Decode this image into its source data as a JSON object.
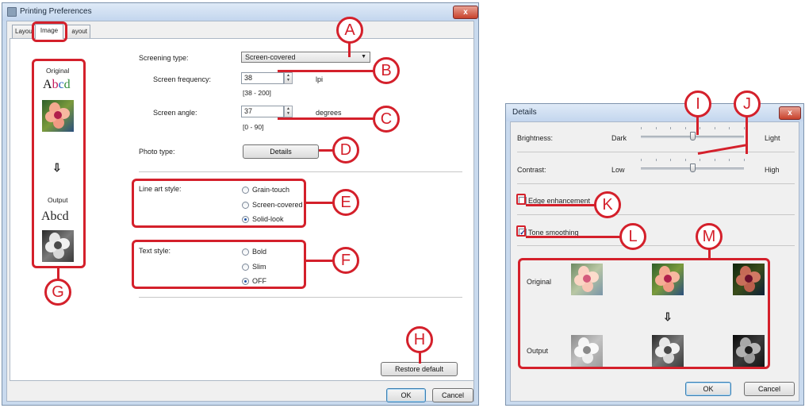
{
  "main_window": {
    "title": "Printing Preferences",
    "close_label": "x",
    "tabs": [
      "Layou",
      "Image",
      "ayout"
    ],
    "preview": {
      "original_label": "Original",
      "sample_text": [
        "A",
        "b",
        "c",
        "d"
      ],
      "arrow": "⇩",
      "output_label": "Output",
      "output_text": "Abcd"
    },
    "screening_type": {
      "label": "Screening type:",
      "value": "Screen-covered"
    },
    "screen_frequency": {
      "label": "Screen frequency:",
      "value": "38",
      "unit": "lpi",
      "range": "[38 - 200]"
    },
    "screen_angle": {
      "label": "Screen angle:",
      "value": "37",
      "unit": "degrees",
      "range": "[0 - 90]"
    },
    "photo_type": {
      "label": "Photo type:",
      "button": "Details"
    },
    "line_art_style": {
      "label": "Line art style:",
      "options": [
        "Grain-touch",
        "Screen-covered",
        "Solid-look"
      ],
      "selected": "Solid-look"
    },
    "text_style": {
      "label": "Text style:",
      "options": [
        "Bold",
        "Slim",
        "OFF"
      ],
      "selected": "OFF"
    },
    "restore_button": "Restore default",
    "ok_button": "OK",
    "cancel_button": "Cancel"
  },
  "details_window": {
    "title": "Details",
    "close_label": "x",
    "brightness": {
      "label": "Brightness:",
      "min_label": "Dark",
      "max_label": "Light",
      "level": 0.5
    },
    "contrast": {
      "label": "Contrast:",
      "min_label": "Low",
      "max_label": "High",
      "level": 0.5
    },
    "edge_enhancement": {
      "label": "Edge enhancement",
      "checked": false
    },
    "tone_smoothing": {
      "label": "Tone smoothing",
      "checked": true
    },
    "preview": {
      "original_label": "Original",
      "arrow": "⇩",
      "output_label": "Output"
    },
    "ok_button": "OK",
    "cancel_button": "Cancel"
  },
  "callouts": [
    "A",
    "B",
    "C",
    "D",
    "E",
    "F",
    "G",
    "H",
    "I",
    "J",
    "K",
    "L",
    "M"
  ],
  "colors": {
    "annotation": "#d4202b",
    "title_bar": "#c9daee",
    "selected_radio": "#2155a7"
  },
  "icons": [
    "printer-icon",
    "close-icon",
    "dropdown-arrow-icon",
    "spin-up-icon",
    "spin-down-icon",
    "down-arrow-icon",
    "checkmark-icon"
  ]
}
